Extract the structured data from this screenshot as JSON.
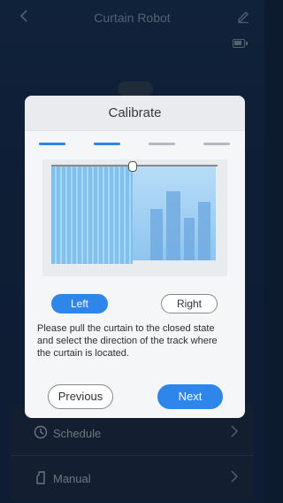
{
  "app": {
    "title": "Curtain Robot",
    "menu": [
      {
        "label": "Schedule",
        "icon": "clock-icon"
      },
      {
        "label": "Manual",
        "icon": "hand-icon"
      }
    ]
  },
  "dialog": {
    "title": "Calibrate",
    "steps": [
      {
        "active": true
      },
      {
        "active": true
      },
      {
        "active": false
      },
      {
        "active": false
      }
    ],
    "step_colors": {
      "active": "#2f86ea",
      "inactive": "#b5b8bd"
    },
    "direction": {
      "left_label": "Left",
      "right_label": "Right",
      "selected": "Left"
    },
    "instruction": "Please pull the curtain to the closed state and select the direction of the track where the curtain is located.",
    "previous_label": "Previous",
    "next_label": "Next"
  },
  "colors": {
    "accent": "#2f86ea",
    "background": "#1e3d6a"
  }
}
